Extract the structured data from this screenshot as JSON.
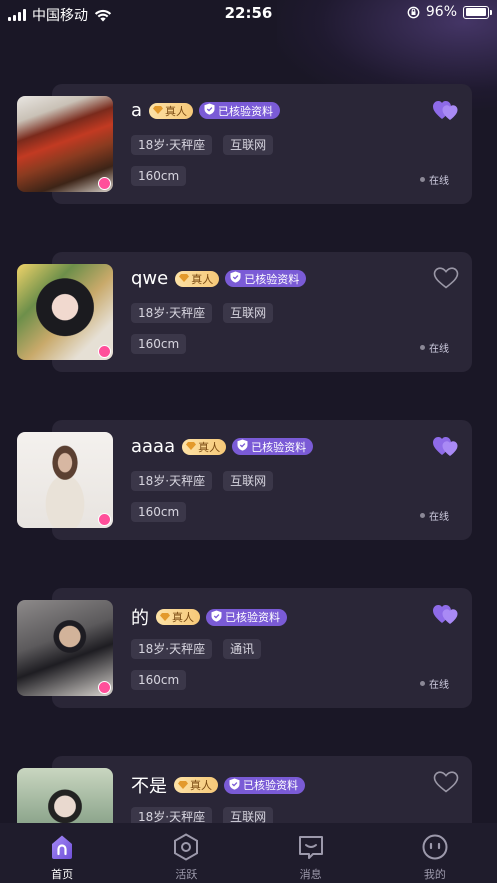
{
  "status_bar": {
    "carrier": "中国移动",
    "time": "22:56",
    "battery": "96%"
  },
  "users": [
    {
      "name": "a",
      "real_label": "真人",
      "verified_label": "已核验资料",
      "tags": [
        "18岁·天秤座",
        "互联网"
      ],
      "height": "160cm",
      "status": "在线",
      "liked": true
    },
    {
      "name": "qwe",
      "real_label": "真人",
      "verified_label": "已核验资料",
      "tags": [
        "18岁·天秤座",
        "互联网"
      ],
      "height": "160cm",
      "status": "在线",
      "liked": false
    },
    {
      "name": "aaaa",
      "real_label": "真人",
      "verified_label": "已核验资料",
      "tags": [
        "18岁·天秤座",
        "互联网"
      ],
      "height": "160cm",
      "status": "在线",
      "liked": true
    },
    {
      "name": "的",
      "real_label": "真人",
      "verified_label": "已核验资料",
      "tags": [
        "18岁·天秤座",
        "通讯"
      ],
      "height": "160cm",
      "status": "在线",
      "liked": true
    },
    {
      "name": "不是",
      "real_label": "真人",
      "verified_label": "已核验资料",
      "tags": [
        "18岁·天秤座",
        "互联网"
      ],
      "height": "",
      "status": "",
      "liked": false
    }
  ],
  "tabs": [
    {
      "label": "首页",
      "icon": "home-icon",
      "active": true
    },
    {
      "label": "活跃",
      "icon": "active-icon",
      "active": false
    },
    {
      "label": "消息",
      "icon": "message-icon",
      "active": false
    },
    {
      "label": "我的",
      "icon": "profile-icon",
      "active": false
    }
  ],
  "colors": {
    "accent": "#7a5bd6",
    "background": "#1a1726",
    "card": "#2a2637",
    "real_badge": "#f6c878",
    "female": "#ff4f9a"
  }
}
